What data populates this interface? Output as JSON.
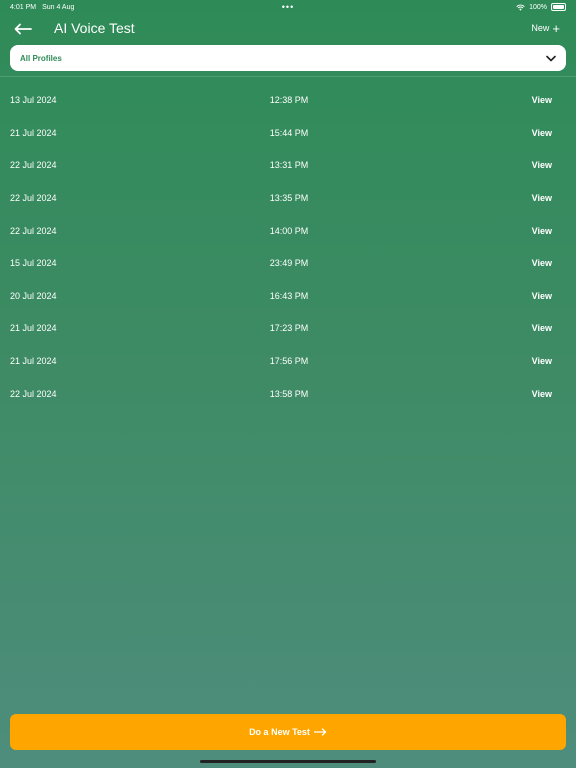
{
  "status_bar": {
    "time": "4:01 PM",
    "date": "Sun 4 Aug",
    "dots": "•••",
    "battery": "100%"
  },
  "header": {
    "title": "AI Voice Test",
    "new_label": "New",
    "plus": "+"
  },
  "filter": {
    "selected": "All Profiles"
  },
  "entries": [
    {
      "date": "13 Jul 2024",
      "time": "12:38 PM",
      "action": "View"
    },
    {
      "date": "21 Jul 2024",
      "time": "15:44 PM",
      "action": "View"
    },
    {
      "date": "22 Jul 2024",
      "time": "13:31 PM",
      "action": "View"
    },
    {
      "date": "22 Jul 2024",
      "time": "13:35 PM",
      "action": "View"
    },
    {
      "date": "22 Jul 2024",
      "time": "14:00 PM",
      "action": "View"
    },
    {
      "date": "15 Jul 2024",
      "time": "23:49 PM",
      "action": "View"
    },
    {
      "date": "20 Jul 2024",
      "time": "16:43 PM",
      "action": "View"
    },
    {
      "date": "21 Jul 2024",
      "time": "17:23 PM",
      "action": "View"
    },
    {
      "date": "21 Jul 2024",
      "time": "17:56 PM",
      "action": "View"
    },
    {
      "date": "22 Jul 2024",
      "time": "13:58 PM",
      "action": "View"
    }
  ],
  "cta": {
    "label": "Do a New Test"
  },
  "colors": {
    "accent": "#ffa500",
    "brand": "#2e8b57"
  }
}
